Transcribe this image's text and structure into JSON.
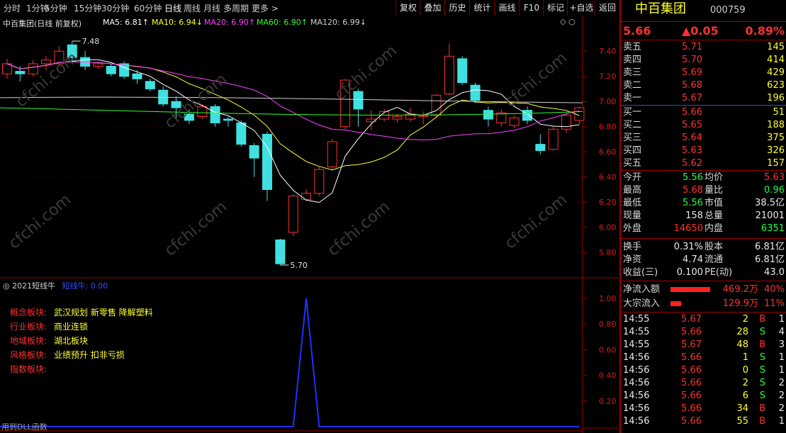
{
  "toolbar": {
    "periods": [
      "分时",
      "1分钟",
      "5分钟",
      "15分钟",
      "30分钟",
      "60分钟",
      "日线",
      "周线",
      "月线",
      "多周期",
      "更多 >"
    ],
    "active": "日线",
    "actions": [
      "复权",
      "叠加",
      "历史",
      "统计",
      "画线",
      "F10",
      "标记",
      "+自选",
      "返回"
    ]
  },
  "chart_header": {
    "title": "中百集团(日线 前复权)",
    "ma": [
      {
        "label": "MA5: 6.81↑",
        "color": "#ffffff"
      },
      {
        "label": "MA10: 6.94↓",
        "color": "#ffff30"
      },
      {
        "label": "MA20: 6.90↑",
        "color": "#ff40ff"
      },
      {
        "label": "MA60: 6.90↑",
        "color": "#30ff30"
      },
      {
        "label": "MA120: 6.99↓",
        "color": "#d0d0d0"
      }
    ],
    "high_marker": "7.48",
    "low_marker": "5.70"
  },
  "chart_data": [
    {
      "type": "candlestick",
      "y_ticks": [
        "7.40",
        "7.20",
        "7.00",
        "6.80",
        "6.60",
        "6.40",
        "6.20",
        "6.00",
        "5.80"
      ],
      "ylim": [
        5.7,
        7.48
      ],
      "candles": [
        {
          "o": 7.22,
          "c": 7.3,
          "h": 7.34,
          "l": 7.18
        },
        {
          "o": 7.24,
          "c": 7.22,
          "h": 7.28,
          "l": 7.16
        },
        {
          "o": 7.22,
          "c": 7.3,
          "h": 7.33,
          "l": 7.2
        },
        {
          "o": 7.3,
          "c": 7.33,
          "h": 7.36,
          "l": 7.25
        },
        {
          "o": 7.3,
          "c": 7.4,
          "h": 7.44,
          "l": 7.28
        },
        {
          "o": 7.45,
          "c": 7.35,
          "h": 7.48,
          "l": 7.3
        },
        {
          "o": 7.35,
          "c": 7.28,
          "h": 7.4,
          "l": 7.25
        },
        {
          "o": 7.28,
          "c": 7.3,
          "h": 7.31,
          "l": 7.26
        },
        {
          "o": 7.28,
          "c": 7.22,
          "h": 7.3,
          "l": 7.2
        },
        {
          "o": 7.3,
          "c": 7.2,
          "h": 7.32,
          "l": 7.18
        },
        {
          "o": 7.22,
          "c": 7.18,
          "h": 7.25,
          "l": 7.14
        },
        {
          "o": 7.16,
          "c": 7.1,
          "h": 7.18,
          "l": 7.08
        },
        {
          "o": 7.09,
          "c": 6.98,
          "h": 7.12,
          "l": 6.96
        },
        {
          "o": 7.0,
          "c": 6.95,
          "h": 7.04,
          "l": 6.86
        },
        {
          "o": 6.9,
          "c": 6.85,
          "h": 6.94,
          "l": 6.82
        },
        {
          "o": 6.88,
          "c": 6.96,
          "h": 6.98,
          "l": 6.86
        },
        {
          "o": 6.96,
          "c": 6.83,
          "h": 6.98,
          "l": 6.8
        },
        {
          "o": 6.86,
          "c": 6.85,
          "h": 6.88,
          "l": 6.8
        },
        {
          "o": 6.83,
          "c": 6.66,
          "h": 6.85,
          "l": 6.64
        },
        {
          "o": 6.65,
          "c": 6.55,
          "h": 6.67,
          "l": 6.4
        },
        {
          "o": 6.74,
          "c": 6.3,
          "h": 6.76,
          "l": 6.21
        },
        {
          "o": 5.9,
          "c": 5.71,
          "h": 5.91,
          "l": 5.7
        },
        {
          "o": 5.96,
          "c": 6.25,
          "h": 6.26,
          "l": 5.93
        },
        {
          "o": 6.22,
          "c": 6.27,
          "h": 6.3,
          "l": 6.21
        },
        {
          "o": 6.27,
          "c": 6.46,
          "h": 6.48,
          "l": 6.25
        },
        {
          "o": 6.48,
          "c": 6.68,
          "h": 6.7,
          "l": 6.46
        },
        {
          "o": 6.8,
          "c": 7.17,
          "h": 7.18,
          "l": 6.78
        },
        {
          "o": 7.08,
          "c": 6.94,
          "h": 7.1,
          "l": 6.8
        },
        {
          "o": 6.84,
          "c": 6.86,
          "h": 6.93,
          "l": 6.77
        },
        {
          "o": 6.86,
          "c": 6.92,
          "h": 6.94,
          "l": 6.84
        },
        {
          "o": 6.86,
          "c": 6.88,
          "h": 6.9,
          "l": 6.83
        },
        {
          "o": 6.86,
          "c": 6.9,
          "h": 6.95,
          "l": 6.84
        },
        {
          "o": 6.88,
          "c": 6.89,
          "h": 6.92,
          "l": 6.82
        },
        {
          "o": 6.89,
          "c": 7.05,
          "h": 7.06,
          "l": 6.87
        },
        {
          "o": 7.06,
          "c": 7.36,
          "h": 7.46,
          "l": 7.05
        },
        {
          "o": 7.34,
          "c": 7.15,
          "h": 7.36,
          "l": 7.13
        },
        {
          "o": 7.13,
          "c": 7.01,
          "h": 7.15,
          "l": 6.99
        },
        {
          "o": 6.93,
          "c": 6.86,
          "h": 6.96,
          "l": 6.8
        },
        {
          "o": 6.83,
          "c": 6.91,
          "h": 6.94,
          "l": 6.8
        },
        {
          "o": 6.81,
          "c": 6.87,
          "h": 6.89,
          "l": 6.79
        },
        {
          "o": 6.93,
          "c": 6.85,
          "h": 6.96,
          "l": 6.82
        },
        {
          "o": 6.66,
          "c": 6.61,
          "h": 6.74,
          "l": 6.58
        },
        {
          "o": 6.62,
          "c": 6.78,
          "h": 6.8,
          "l": 6.61
        },
        {
          "o": 6.78,
          "c": 6.89,
          "h": 6.91,
          "l": 6.75
        },
        {
          "o": 6.85,
          "c": 6.95,
          "h": 6.96,
          "l": 6.82
        }
      ]
    },
    {
      "type": "line",
      "y_ticks": [
        "1.00",
        "0.80",
        "0.60",
        "0.40",
        "0.20"
      ],
      "ylim": [
        0,
        1.05
      ],
      "values": [
        0,
        0,
        0,
        0,
        0,
        0,
        0,
        0,
        0,
        0,
        0,
        0,
        0,
        0,
        0,
        0,
        0,
        0,
        0,
        0,
        0,
        0,
        0,
        1,
        0,
        0,
        0,
        0,
        0,
        0,
        0,
        0,
        0,
        0,
        0,
        0,
        0,
        0,
        0,
        0,
        0,
        0,
        0,
        0,
        0
      ]
    }
  ],
  "indicator": {
    "name": "2021短线牛",
    "series_label": "短线牛: 0.00",
    "rows": [
      {
        "k": "概念板块:",
        "v": "武汉规划 新零售 降解塑料"
      },
      {
        "k": "行业板块:",
        "v": "商业连锁"
      },
      {
        "k": "地域板块:",
        "v": "湖北板块"
      },
      {
        "k": "风格板块:",
        "v": "业绩预升 扣非亏损"
      },
      {
        "k": "指数板块:",
        "v": ""
      }
    ],
    "footer": "用到DLL函数"
  },
  "stock": {
    "name": "中百集团",
    "code": "000759",
    "price": "5.66",
    "change": "▲0.05",
    "pct": "0.89%"
  },
  "order_book": [
    {
      "label": "卖五",
      "price": "5.71",
      "vol": "145"
    },
    {
      "label": "卖四",
      "price": "5.70",
      "vol": "414"
    },
    {
      "label": "卖三",
      "price": "5.69",
      "vol": "429"
    },
    {
      "label": "卖二",
      "price": "5.68",
      "vol": "623"
    },
    {
      "label": "卖一",
      "price": "5.67",
      "vol": "196"
    },
    {
      "label": "买一",
      "price": "5.66",
      "vol": "51"
    },
    {
      "label": "买二",
      "price": "5.65",
      "vol": "188"
    },
    {
      "label": "买三",
      "price": "5.64",
      "vol": "375"
    },
    {
      "label": "买四",
      "price": "5.63",
      "vol": "326"
    },
    {
      "label": "买五",
      "price": "5.62",
      "vol": "157"
    }
  ],
  "stats": [
    {
      "l1": "今开",
      "v1": "5.56",
      "c1": "green",
      "l2": "均价",
      "v2": "5.63",
      "c2": "red"
    },
    {
      "l1": "最高",
      "v1": "5.68",
      "c1": "red",
      "l2": "量比",
      "v2": "0.96",
      "c2": "green"
    },
    {
      "l1": "最低",
      "v1": "5.56",
      "c1": "green",
      "l2": "市值",
      "v2": "38.5亿",
      "c2": "white"
    },
    {
      "l1": "现量",
      "v1": "158",
      "c1": "white",
      "l2": "总量",
      "v2": "21001",
      "c2": "white"
    },
    {
      "l1": "外盘",
      "v1": "14650",
      "c1": "red",
      "l2": "内盘",
      "v2": "6351",
      "c2": "green"
    }
  ],
  "stats2": [
    {
      "l1": "换手",
      "v1": "0.31%",
      "l2": "股本",
      "v2": "6.81亿"
    },
    {
      "l1": "净资",
      "v1": "4.74",
      "l2": "流通",
      "v2": "6.81亿"
    },
    {
      "l1": "收益(三)",
      "v1": "0.100",
      "l2": "PE(动)",
      "v2": "43.0"
    }
  ],
  "flows": [
    {
      "label": "净流入额",
      "value": "469.2万",
      "pct": "40%",
      "bar": 0.4
    },
    {
      "label": "大宗流入",
      "value": "129.9万",
      "pct": "11%",
      "bar": 0.11
    }
  ],
  "ticks": [
    {
      "t": "14:55",
      "p": "5.67",
      "v": "2",
      "s": "B",
      "n": "1"
    },
    {
      "t": "14:55",
      "p": "5.66",
      "v": "28",
      "s": "S",
      "n": "4"
    },
    {
      "t": "14:55",
      "p": "5.67",
      "v": "48",
      "s": "B",
      "n": "3"
    },
    {
      "t": "14:56",
      "p": "5.66",
      "v": "1",
      "s": "S",
      "n": "1"
    },
    {
      "t": "14:56",
      "p": "5.66",
      "v": "0",
      "s": "S",
      "n": "1"
    },
    {
      "t": "14:56",
      "p": "5.66",
      "v": "2",
      "s": "S",
      "n": "2"
    },
    {
      "t": "14:56",
      "p": "5.66",
      "v": "6",
      "s": "S",
      "n": "2"
    },
    {
      "t": "14:56",
      "p": "5.66",
      "v": "34",
      "s": "B",
      "n": "2"
    },
    {
      "t": "14:56",
      "p": "5.66",
      "v": "55",
      "s": "B",
      "n": "1"
    }
  ],
  "watermark": "cfchi.com"
}
